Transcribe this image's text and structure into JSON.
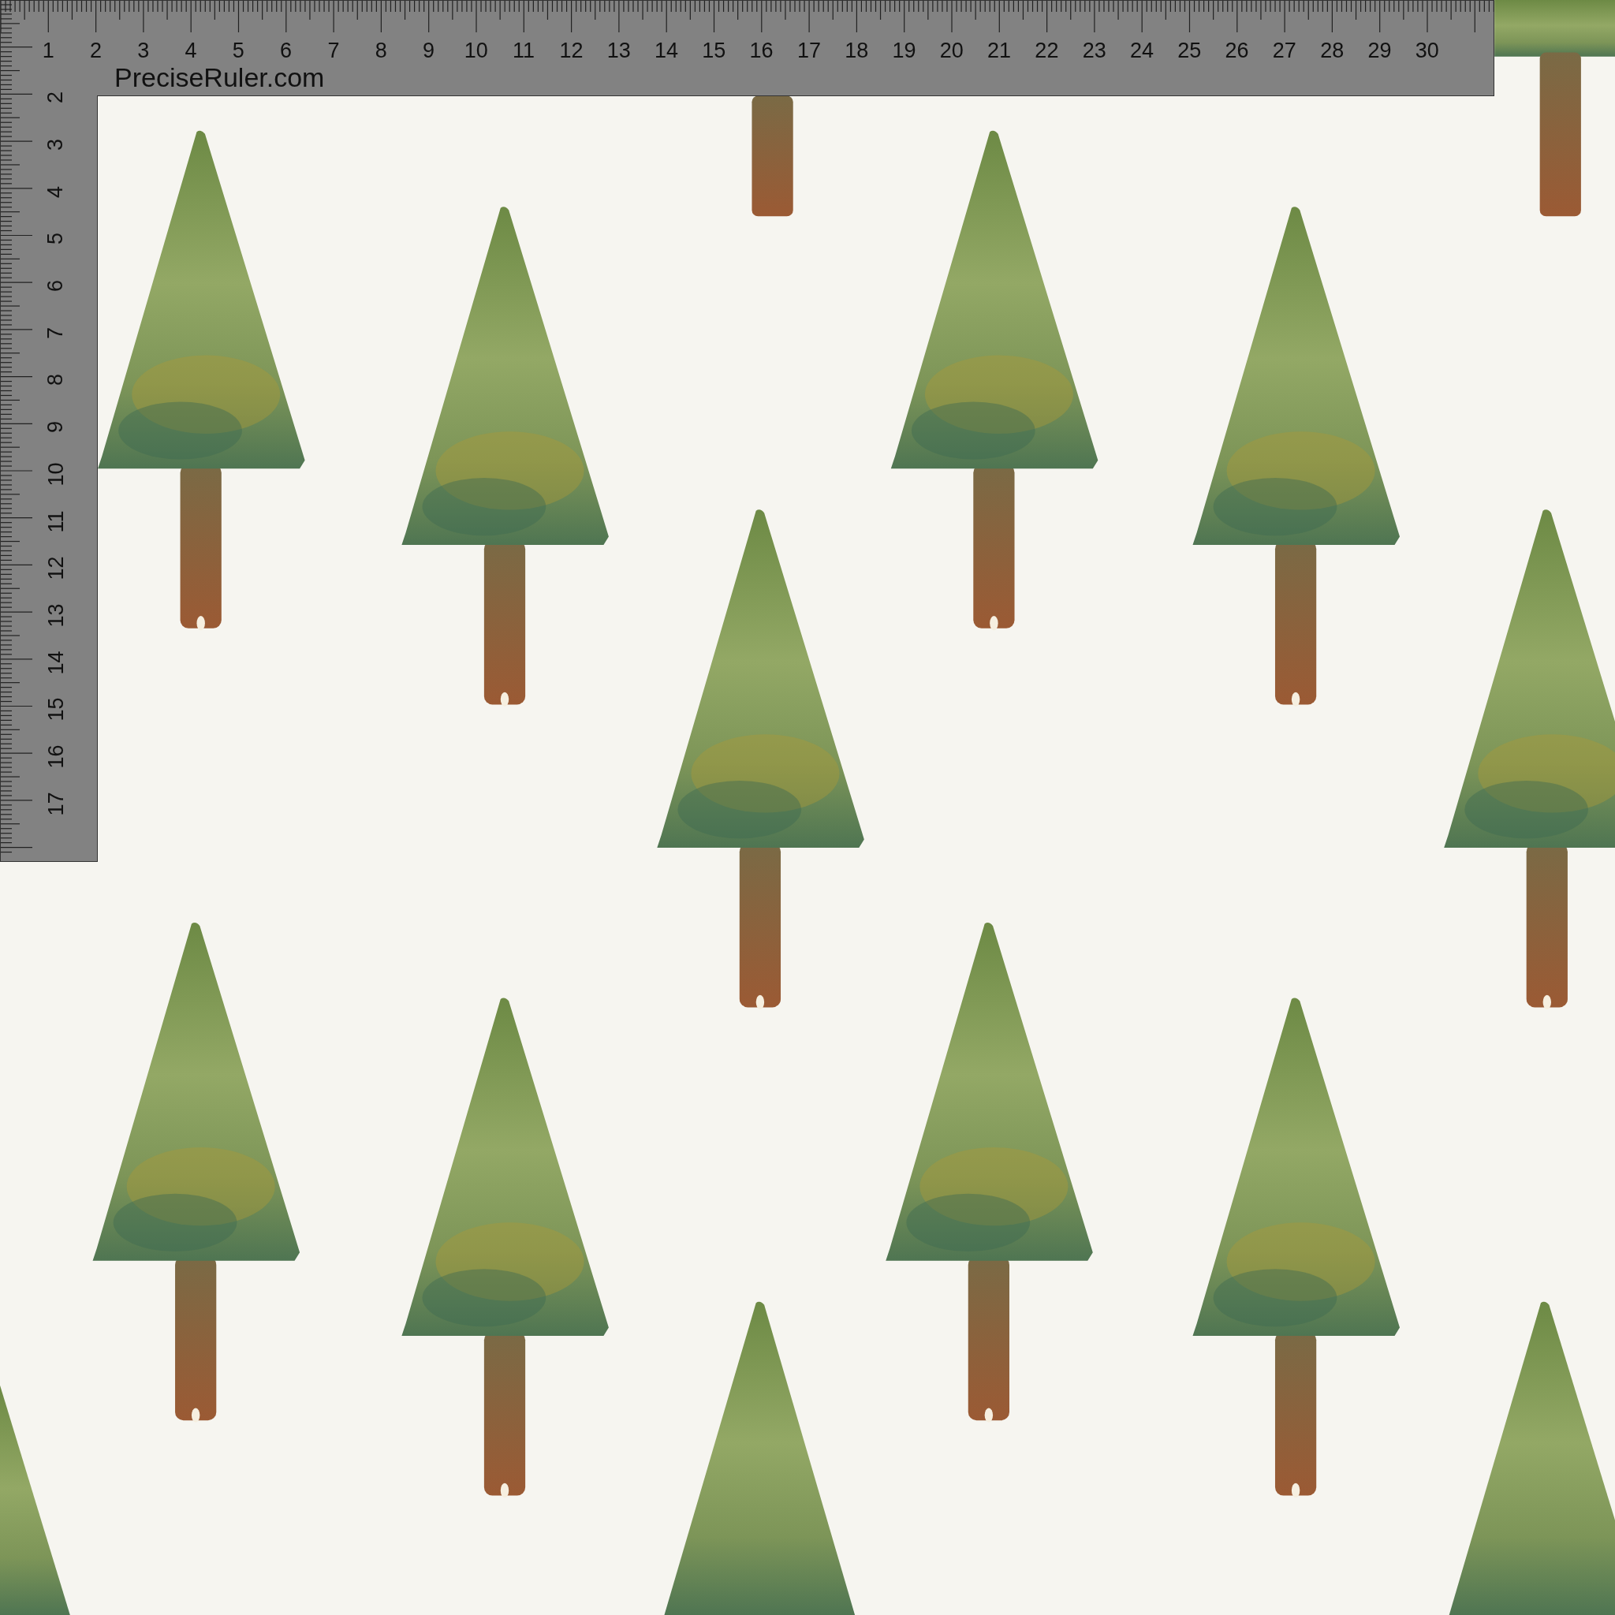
{
  "ruler": {
    "brand": "PreciseRuler.com",
    "top_marks": [
      "1",
      "2",
      "3",
      "4",
      "5",
      "6",
      "7",
      "8",
      "9",
      "10",
      "11",
      "12",
      "13",
      "14",
      "15",
      "16",
      "17",
      "18",
      "19",
      "20",
      "21",
      "22",
      "23",
      "24",
      "25",
      "26",
      "27",
      "28",
      "29",
      "30"
    ],
    "side_marks": [
      "2",
      "3",
      "4",
      "5",
      "6",
      "7",
      "8",
      "9",
      "10",
      "11",
      "12",
      "13",
      "14",
      "15",
      "16",
      "17"
    ]
  }
}
